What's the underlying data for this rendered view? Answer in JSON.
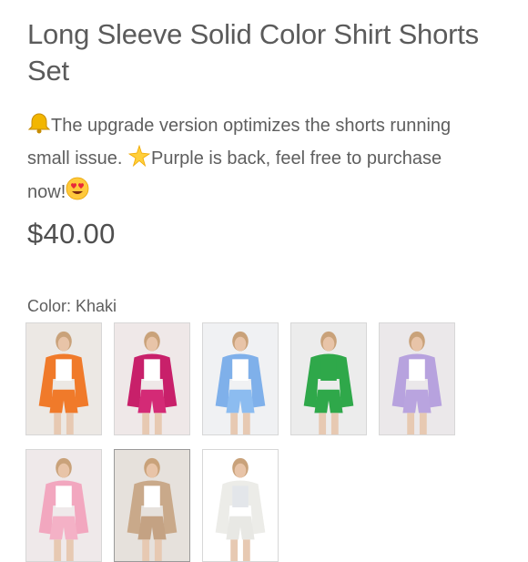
{
  "product": {
    "title": "Long Sleeve Solid Color Shirt Shorts Set",
    "description_line1_text": "The upgrade version optimizes the shorts running",
    "description_line2_text_a": "small issue. ",
    "description_line2_text_b": "Purple is back, feel free to purchase",
    "description_line3_text": "now!",
    "icons": {
      "bell": "bell-icon",
      "sparkle": "sparkle-icon",
      "heart_eyes": "heart-eyes-icon"
    },
    "price": "$40.00"
  },
  "color_selector": {
    "label": "Color:",
    "selected": "Khaki",
    "options": [
      {
        "name": "orange-swatch",
        "main": "#f07a2a",
        "bg": "#ece8e4",
        "inner": "#ffffff",
        "bottom": "#f07a2a"
      },
      {
        "name": "rose-swatch",
        "main": "#c8206a",
        "bg": "#efe8e8",
        "inner": "#ffffff",
        "bottom": "#d42a76"
      },
      {
        "name": "light-blue-swatch",
        "main": "#7fb0ea",
        "bg": "#f0f1f3",
        "inner": "#ffffff",
        "bottom": "#8cbcf0"
      },
      {
        "name": "green-swatch",
        "main": "#2fa84a",
        "bg": "#ececec",
        "inner": "#2fa84a",
        "bottom": "#2fa84a"
      },
      {
        "name": "purple-swatch",
        "main": "#b7a2de",
        "bg": "#ebe8ea",
        "inner": "#ffffff",
        "bottom": "#b9a4df"
      },
      {
        "name": "pink-swatch",
        "main": "#f2a7bf",
        "bg": "#efe9ea",
        "inner": "#ffffff",
        "bottom": "#f4b1c6"
      },
      {
        "name": "khaki-swatch",
        "main": "#c9a98a",
        "bg": "#e6e1dc",
        "inner": "#ffffff",
        "bottom": "#c4a283"
      },
      {
        "name": "white-swatch",
        "main": "#ecece8",
        "bg": "#ffffff",
        "inner": "#e3e6ea",
        "bottom": "#e8e8e4"
      }
    ]
  }
}
